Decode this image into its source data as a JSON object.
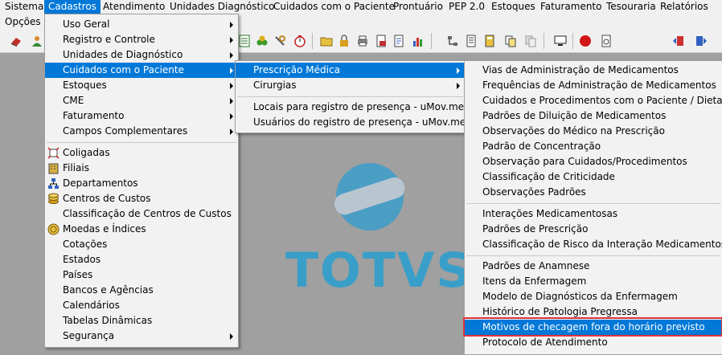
{
  "menubar": [
    "Sistema",
    "Cadastros",
    "Atendimento",
    "Unidades Diagnóstico",
    "Cuidados com o Paciente",
    "Prontuário",
    "PEP 2.0",
    "Estoques",
    "Faturamento",
    "Tesouraria",
    "Relatórios",
    "Opções"
  ],
  "cadastros_menu": [
    "Uso Geral",
    "Registro e Controle",
    "Unidades de Diagnóstico",
    "Cuidados com o Paciente",
    "Estoques",
    "CME",
    "Faturamento",
    "Campos Complementares",
    "Coligadas",
    "Filiais",
    "Departamentos",
    "Centros de Custos",
    "Classificação de Centros de Custos",
    "Moedas e Índices",
    "Cotações",
    "Estados",
    "Países",
    "Bancos e Agências",
    "Calendários",
    "Tabelas Dinâmicas",
    "Segurança"
  ],
  "cuidados_menu": [
    "Prescrição Médica",
    "Cirurgias",
    "Locais para registro de presença - uMov.me",
    "Usuários do registro de presença - uMov.me"
  ],
  "prescricao_menu": [
    "Vias de Administração de Medicamentos",
    "Frequências de Administração de Medicamentos",
    "Cuidados e Procedimentos com o Paciente / Dieta",
    "Padrões de Diluição de Medicamentos",
    "Observações do Médico na Prescrição",
    "Padrão de Concentração",
    "Observação para Cuidados/Procedimentos",
    "Classificação de Criticidade",
    "Observações Padrões",
    "Interações Medicamentosas",
    "Padrões de Prescrição",
    "Classificação de Risco da Interação Medicamentosa",
    "Padrões de Anamnese",
    "Itens da Enfermagem",
    "Modelo de Diagnósticos da Enfermagem",
    "Histórico de Patologia Pregressa",
    "Motivos de checagem fora do horário previsto",
    "Protocolo de Atendimento"
  ],
  "logo": {
    "text": "TOTVS"
  },
  "colors": {
    "highlight": "#0078d7",
    "logo": "#3a9fc8",
    "red_box": "#e0323c"
  }
}
